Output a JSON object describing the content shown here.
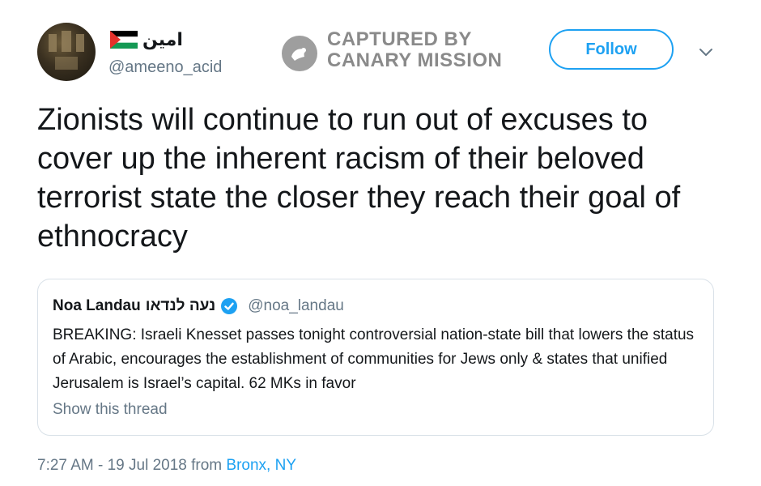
{
  "author": {
    "display_name": "امين",
    "handle": "@ameeno_acid",
    "flag_icon": "palestine-flag-icon"
  },
  "watermark": {
    "line1": "CAPTURED BY",
    "line2": "CANARY MISSION"
  },
  "follow_label": "Follow",
  "tweet_text": "Zionists will continue to run out of excuses to cover up the inherent racism of their beloved terrorist state the closer they reach their goal of ethnocracy",
  "quoted": {
    "name": "Noa Landau",
    "name_hebrew": "נעה לנדאו",
    "handle": "@noa_landau",
    "text": "BREAKING: Israeli Knesset passes tonight controversial nation-state bill that lowers the status of Arabic, encourages the establishment of communities for Jews only & states that unified Jerusalem is Israel’s capital. 62 MKs in favor",
    "show_thread": "Show this thread"
  },
  "timestamp": {
    "time": "7:27 AM - 19 Jul 2018 from ",
    "location": "Bronx, NY"
  },
  "colors": {
    "accent": "#1da1f2",
    "secondary_text": "#657786",
    "border": "#d9e1e8"
  }
}
